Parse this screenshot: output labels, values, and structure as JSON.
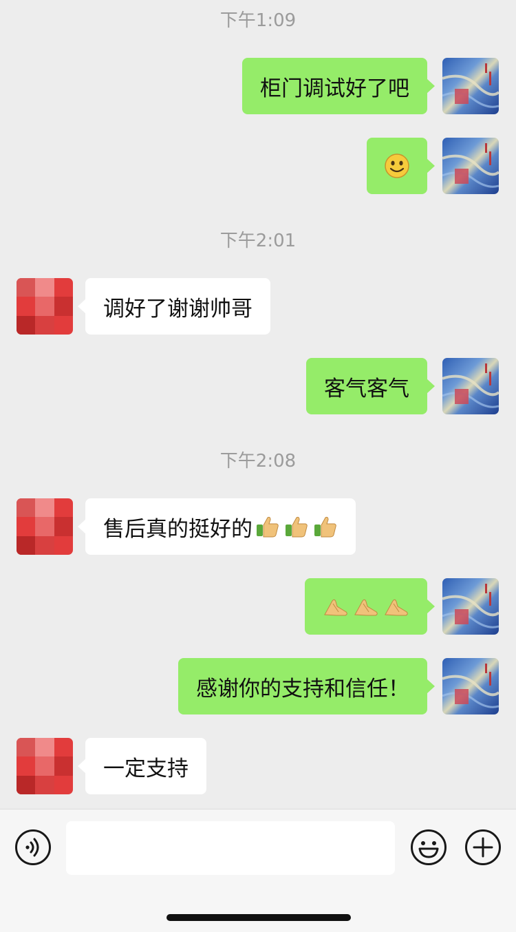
{
  "colors": {
    "background": "#ededed",
    "sent_bubble": "#95ec69",
    "received_bubble": "#ffffff",
    "timestamp": "#9b9b9b"
  },
  "timestamps": [
    "下午1:09",
    "下午2:01",
    "下午2:08"
  ],
  "messages": [
    {
      "side": "me",
      "text": "柜门调试好了吧"
    },
    {
      "side": "me",
      "emoji": "smile-emoji"
    },
    {
      "side": "them",
      "text": "调好了谢谢帅哥"
    },
    {
      "side": "me",
      "text": "客气客气"
    },
    {
      "side": "them",
      "text": "售后真的挺好的",
      "emojis": [
        "thumbs-up-emoji",
        "thumbs-up-emoji",
        "thumbs-up-emoji"
      ]
    },
    {
      "side": "me",
      "emojis": [
        "fist-bump-emoji",
        "fist-bump-emoji",
        "fist-bump-emoji"
      ]
    },
    {
      "side": "me",
      "text": "感谢你的支持和信任！"
    },
    {
      "side": "them",
      "text": "一定支持"
    }
  ],
  "input_bar": {
    "icons": [
      "voice-icon",
      "emoji-face-icon",
      "plus-icon"
    ],
    "input_value": ""
  }
}
